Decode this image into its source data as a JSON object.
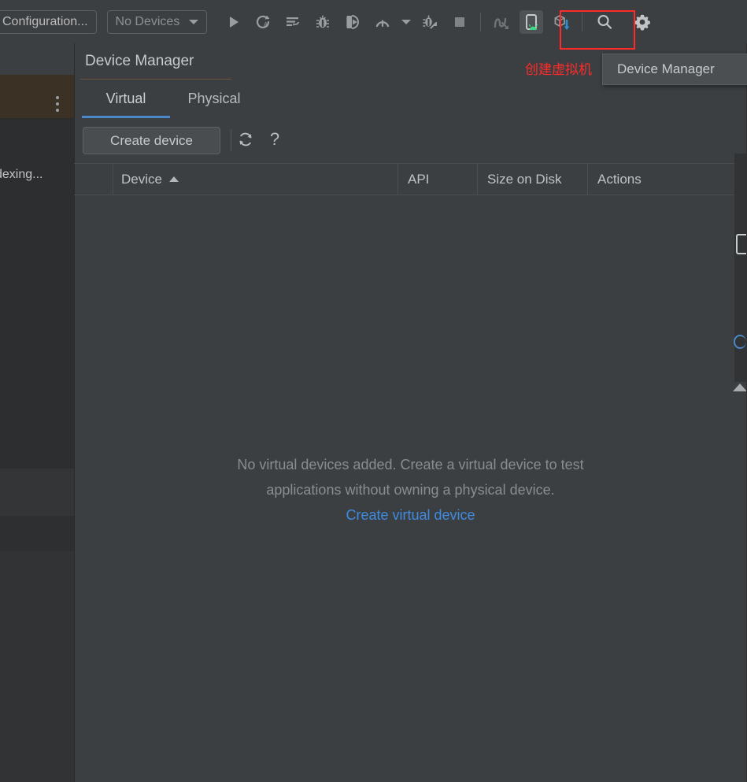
{
  "toolbar": {
    "run_config_label": "Configuration...",
    "device_selector_label": "No Devices",
    "buttons": [
      {
        "name": "run-button",
        "icon": "play-icon",
        "tip": "Run"
      },
      {
        "name": "run-with-coverage-button",
        "icon": "coverage-icon",
        "tip": "Run with Coverage"
      },
      {
        "name": "profiler-button",
        "icon": "profiler-icon",
        "tip": "Profile"
      },
      {
        "name": "debug-button",
        "icon": "bug-icon",
        "tip": "Debug"
      },
      {
        "name": "attach-debugger-button",
        "icon": "attach-debugger-icon",
        "tip": "Attach Debugger"
      },
      {
        "name": "apply-changes-button",
        "icon": "apply-changes-icon",
        "tip": "Apply Changes"
      },
      {
        "name": "apply-changes-dropdown",
        "icon": "chevron-down-icon",
        "tip": "More"
      },
      {
        "name": "debug-attach-button",
        "icon": "bug-attach-icon",
        "tip": "Attach to Process"
      },
      {
        "name": "stop-button",
        "icon": "stop-icon",
        "tip": "Stop"
      },
      {
        "name": "layout-inspector-button",
        "icon": "layout-inspector-icon",
        "tip": "Layout Inspector"
      },
      {
        "name": "device-manager-button",
        "icon": "device-manager-icon",
        "tip": "Device Manager"
      },
      {
        "name": "sdk-manager-button",
        "icon": "sdk-manager-icon",
        "tip": "SDK Manager"
      },
      {
        "name": "search-everywhere-button",
        "icon": "search-icon",
        "tip": "Search Everywhere"
      },
      {
        "name": "settings-button",
        "icon": "gear-icon",
        "tip": "Settings"
      }
    ]
  },
  "annotation": {
    "note_text": "创建虚拟机",
    "note_color": "#ff2a2a",
    "box_color": "#ff2a2a"
  },
  "tooltip": {
    "text": "Device Manager"
  },
  "sidebar": {
    "status_text": "dexing...",
    "overflow_menu": "more-options"
  },
  "panel": {
    "title": "Device Manager",
    "tabs": [
      {
        "label": "Virtual",
        "active": true
      },
      {
        "label": "Physical",
        "active": false
      }
    ],
    "actions": {
      "create_device_label": "Create device",
      "refresh_icon": "refresh-icon",
      "help_icon": "help-icon"
    },
    "table": {
      "columns": [
        "",
        "Device",
        "API",
        "Size on Disk",
        "Actions"
      ],
      "sort_column": "Device",
      "sort_direction": "ascending",
      "rows": []
    },
    "empty_state": {
      "line1": "No virtual devices added. Create a virtual device to test",
      "line2": "applications without owning a physical device.",
      "link": "Create virtual device",
      "link_color": "#3f8be0"
    }
  },
  "theme": {
    "background": "#3c3f41",
    "panel_background": "#3c3f41",
    "sidebar_background": "#313335",
    "accent": "#4a88c7",
    "text": "#c8cbcd",
    "muted_text": "#8a8d8f",
    "highlight_bar": "#3b3225"
  }
}
